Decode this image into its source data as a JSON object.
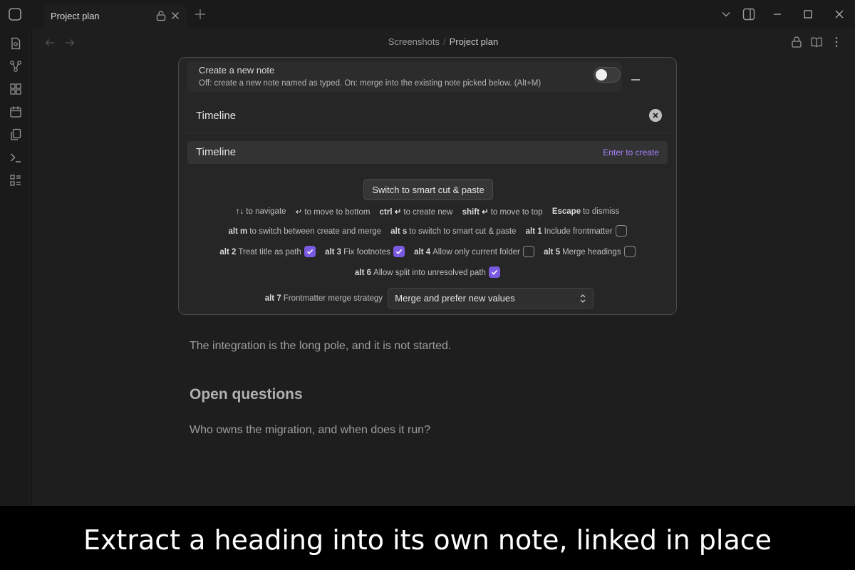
{
  "tab": {
    "title": "Project plan"
  },
  "breadcrumb": {
    "parent": "Screenshots",
    "separator": "/",
    "current": "Project plan"
  },
  "document": {
    "paragraph_1": "The integration is the long pole, and it is not started.",
    "heading_open_questions": "Open questions",
    "paragraph_2": "Who owns the migration, and when does it run?"
  },
  "modal": {
    "toggle": {
      "title": "Create a new note",
      "description": "Off: create a new note named as typed. On: merge into the existing note picked below. (Alt+M)",
      "state": "off"
    },
    "search": {
      "value": "Timeline"
    },
    "suggestion": {
      "label": "Timeline",
      "hint": "Enter to create"
    },
    "smart_button": "Switch to smart cut & paste",
    "nav_hints": [
      {
        "key": "↑↓",
        "text": "to navigate"
      },
      {
        "key": "↵",
        "text": "to move to bottom"
      },
      {
        "key": "ctrl ↵",
        "text": "to create new"
      },
      {
        "key": "shift ↵",
        "text": "to move to top"
      },
      {
        "key": "Escape",
        "text": "to dismiss"
      }
    ],
    "alt_hints": [
      {
        "key": "alt m",
        "text": "to switch between create and merge"
      },
      {
        "key": "alt s",
        "text": "to switch to smart cut & paste"
      }
    ],
    "options": [
      {
        "key": "alt 1",
        "text": "Include frontmatter",
        "checked": false
      },
      {
        "key": "alt 2",
        "text": "Treat title as path",
        "checked": true
      },
      {
        "key": "alt 3",
        "text": "Fix footnotes",
        "checked": true
      },
      {
        "key": "alt 4",
        "text": "Allow only current folder",
        "checked": false
      },
      {
        "key": "alt 5",
        "text": "Merge headings",
        "checked": false
      },
      {
        "key": "alt 6",
        "text": "Allow split into unresolved path",
        "checked": true
      }
    ],
    "strategy": {
      "key": "alt 7",
      "label": "Frontmatter merge strategy",
      "value": "Merge and prefer new values"
    }
  },
  "caption": "Extract a heading into its own note, linked in place",
  "colors": {
    "accent": "#7a5ae0",
    "hint_purple": "#a882ff",
    "background": "#1e1e1e",
    "modal_bg": "#262626"
  }
}
